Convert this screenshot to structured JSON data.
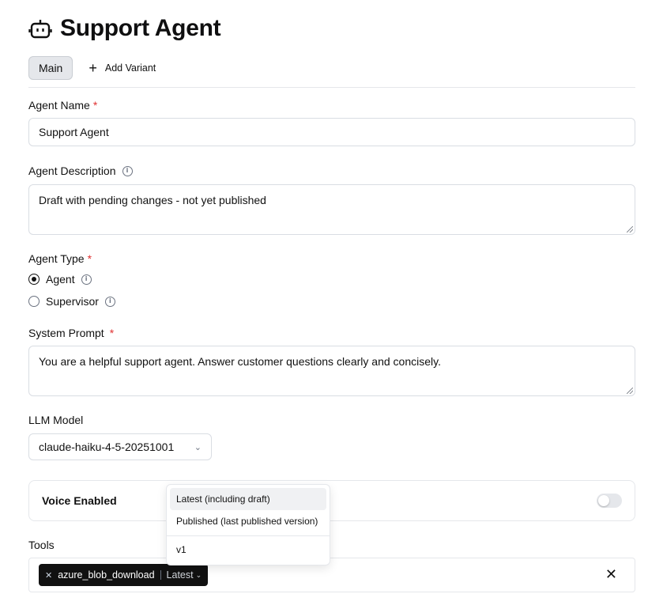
{
  "header": {
    "title": "Support Agent",
    "icon": "robot-icon"
  },
  "tabs": {
    "main_label": "Main",
    "add_variant_label": "Add Variant"
  },
  "form": {
    "agent_name": {
      "label": "Agent Name",
      "required_mark": "*",
      "value": "Support Agent"
    },
    "agent_description": {
      "label": "Agent Description",
      "value": "Draft with pending changes - not yet published"
    },
    "agent_type": {
      "label": "Agent Type",
      "required_mark": "*",
      "options": [
        {
          "label": "Agent",
          "checked": true
        },
        {
          "label": "Supervisor",
          "checked": false
        }
      ]
    },
    "system_prompt": {
      "label": "System Prompt",
      "required_mark": "*",
      "value": "You are a helpful support agent. Answer customer questions clearly and concisely."
    },
    "llm_model": {
      "label": "LLM Model",
      "value": "claude-haiku-4-5-20251001"
    },
    "voice": {
      "label": "Voice Enabled",
      "enabled": false
    },
    "tools": {
      "label": "Tools",
      "chips": [
        {
          "name": "azure_blob_download",
          "version": "Latest"
        }
      ]
    }
  },
  "version_dropdown": {
    "items": [
      {
        "label": "Latest (including draft)",
        "highlighted": true
      },
      {
        "label": "Published (last published version)",
        "highlighted": false
      }
    ],
    "versions": [
      "v1"
    ]
  },
  "colors": {
    "required": "#e03131",
    "chip_bg": "#111111",
    "tab_active_bg": "#e5e7eb"
  }
}
